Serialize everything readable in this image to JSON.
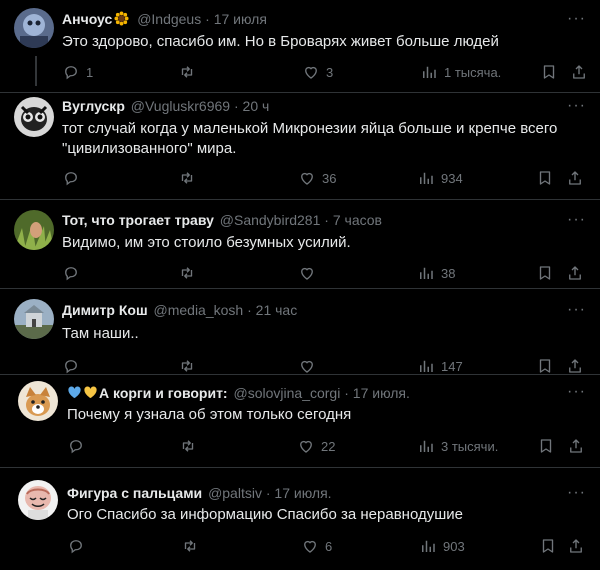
{
  "tweets": [
    {
      "name": "Анчоус",
      "handle": "@Indgeus",
      "time": "17 июля",
      "text": "Это здорово, спасибо им. Но в Броварях живет больше людей",
      "replies": "1",
      "retweets": "",
      "likes": "3",
      "views": "1 тысяча."
    },
    {
      "name": "Вуглускр",
      "handle": "@Vugluskr6969",
      "time": "20 ч",
      "text": "тот случай когда у маленькой Микронезии яйца больше и крепче всего \"цивилизованного\" мира.",
      "replies": "",
      "retweets": "",
      "likes": "36",
      "views": "934"
    },
    {
      "name": "Тот, что трогает траву",
      "handle": "@Sandybird281",
      "time": "7 часов",
      "text": "Видимо, им это стоило безумных усилий.",
      "replies": "",
      "retweets": "",
      "likes": "",
      "views": "38"
    },
    {
      "name": "Димитр Кош",
      "handle": "@media_kosh",
      "time": "21 час",
      "text": "Там наши..",
      "replies": "",
      "retweets": "",
      "likes": "",
      "views": "147"
    },
    {
      "name": "А корги и говорит:",
      "handle": "@solovjina_corgi",
      "time": "17 июля.",
      "text": "Почему я узнала об этом только сегодня",
      "replies": "",
      "retweets": "",
      "likes": "22",
      "views": "3 тысячи."
    },
    {
      "name": "Фигура с пальцами",
      "handle": "@paltsiv",
      "time": "17 июля.",
      "text": "Ого Спасибо за информацию Спасибо за неравнодушие",
      "replies": "",
      "retweets": "",
      "likes": "6",
      "views": "903"
    }
  ],
  "separator": " · ",
  "more_glyph": "···",
  "colors": {
    "background": "#000000",
    "text": "#e7e9ea",
    "secondary": "#71767b",
    "divider": "#2f3336"
  }
}
